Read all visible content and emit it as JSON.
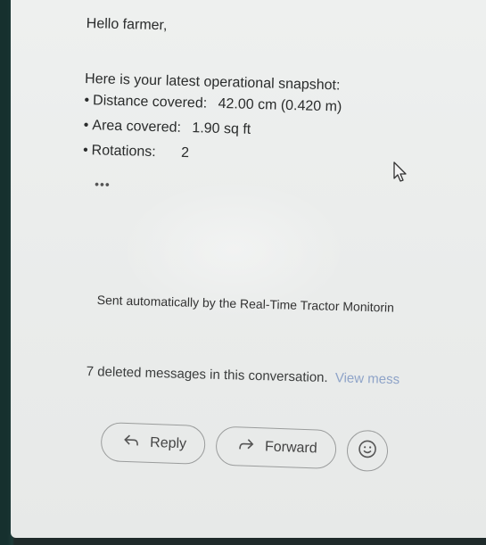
{
  "email": {
    "greeting": "Hello farmer,",
    "intro": "Here is your latest operational snapshot:",
    "stats": [
      {
        "label": "Distance covered:",
        "value": "42.00 cm (0.420 m)"
      },
      {
        "label": "Area covered:",
        "value": "1.90 sq ft"
      },
      {
        "label": "Rotations:",
        "value": "2"
      }
    ],
    "ellipsis": "•••",
    "footer": "Sent automatically by the Real-Time Tractor Monitorin"
  },
  "thread": {
    "deleted_text": "7 deleted messages in this conversation.",
    "view_link": "View mess"
  },
  "actions": {
    "reply_label": "Reply",
    "forward_label": "Forward",
    "reply_icon": "reply-arrow-icon",
    "forward_icon": "forward-arrow-icon",
    "emoji_icon": "emoji-smiley-icon"
  }
}
